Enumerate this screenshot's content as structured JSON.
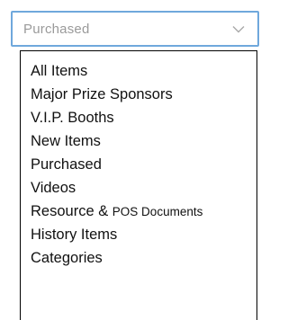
{
  "select": {
    "value": "Purchased",
    "icon": "chevron-down-icon",
    "accent_color": "#6fa8dc"
  },
  "menu": {
    "items": [
      {
        "label": "All Items"
      },
      {
        "label": "Major Prize Sponsors"
      },
      {
        "label": "V.I.P. Booths"
      },
      {
        "label": "New Items"
      },
      {
        "label": "Purchased"
      },
      {
        "label": "Videos"
      },
      {
        "label": "Resource & ",
        "label_suffix": "POS Documents"
      },
      {
        "label": "History Items"
      },
      {
        "label": "Categories"
      }
    ]
  }
}
